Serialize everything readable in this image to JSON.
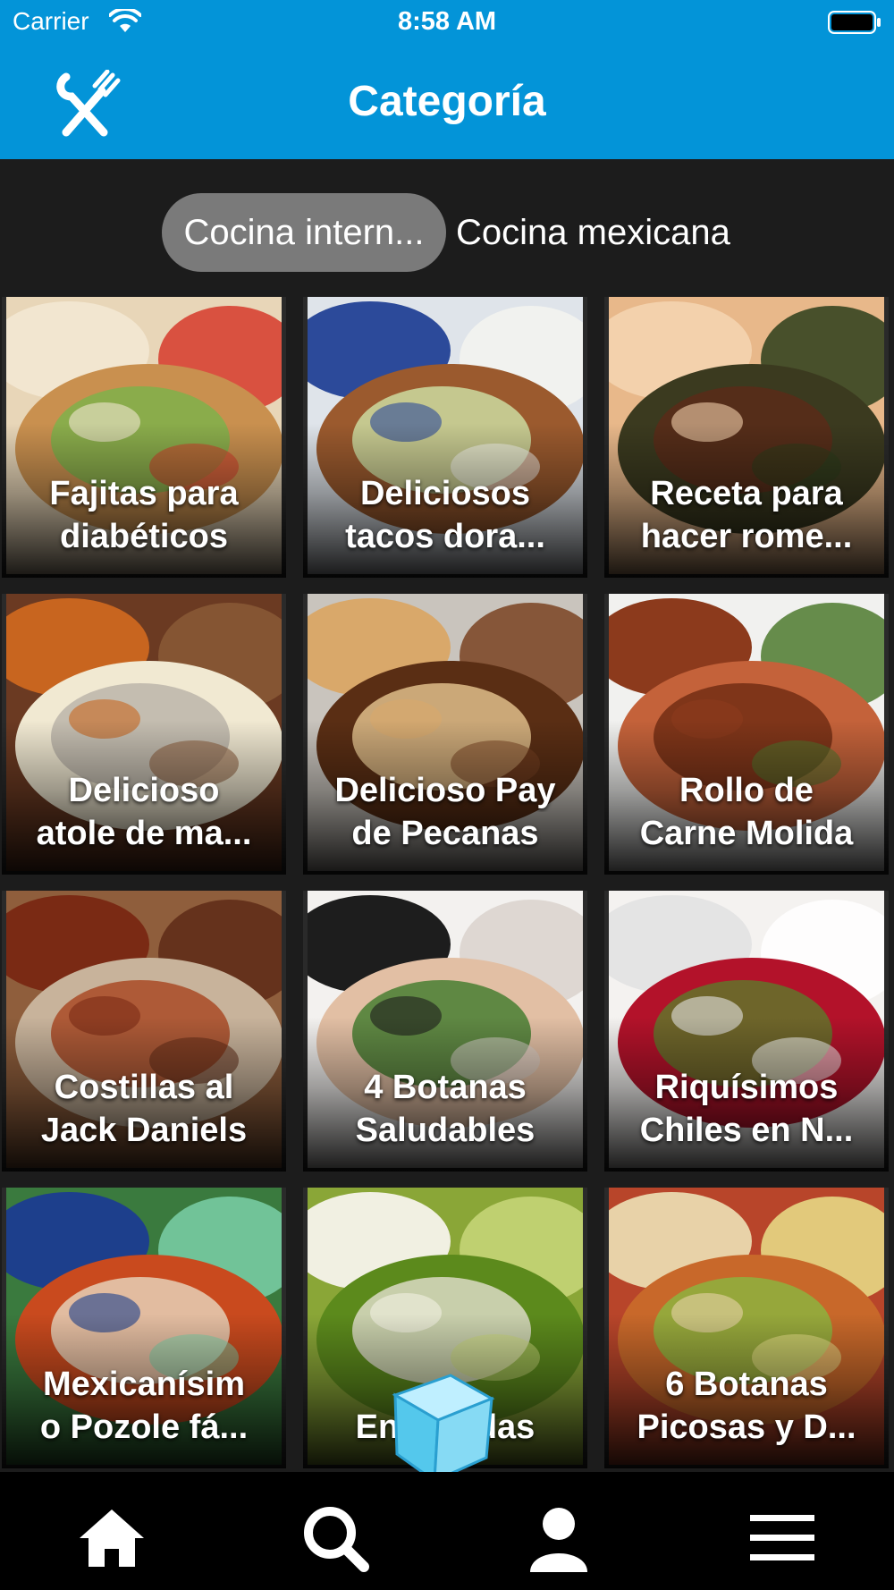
{
  "status": {
    "carrier": "Carrier",
    "time": "8:58 AM"
  },
  "header": {
    "title": "Categoría",
    "logo_icon": "fork-knife-icon"
  },
  "tabs": [
    {
      "label": "Cocina intern...",
      "selected": true
    },
    {
      "label": "Cocina mexicana",
      "selected": false
    }
  ],
  "recipes": [
    {
      "line1": "Fajitas para",
      "line2": "diabéticos"
    },
    {
      "line1": "Deliciosos",
      "line2": "tacos dora..."
    },
    {
      "line1": "Receta para",
      "line2": "hacer rome..."
    },
    {
      "line1": "Delicioso",
      "line2": "atole de ma..."
    },
    {
      "line1": "Delicioso Pay",
      "line2": "de Pecanas"
    },
    {
      "line1": "Rollo de",
      "line2": "Carne Molida"
    },
    {
      "line1": "Costillas al",
      "line2": "Jack Daniels"
    },
    {
      "line1": "4 Botanas",
      "line2": "Saludables"
    },
    {
      "line1": "Riquísimos",
      "line2": "Chiles en N..."
    },
    {
      "line1": "Mexicanísim",
      "line2": "o Pozole fá..."
    },
    {
      "line1": "Enchiladas",
      "line2": ""
    },
    {
      "line1": "6 Botanas",
      "line2": "Picosas y D..."
    }
  ],
  "bottom_nav": [
    "home-icon",
    "search-icon",
    "profile-icon",
    "menu-icon"
  ],
  "colors": {
    "header": "#0394d8",
    "background": "#1c1c1c",
    "tab_active": "#7a7a7a",
    "tab_bar": "#000000"
  }
}
